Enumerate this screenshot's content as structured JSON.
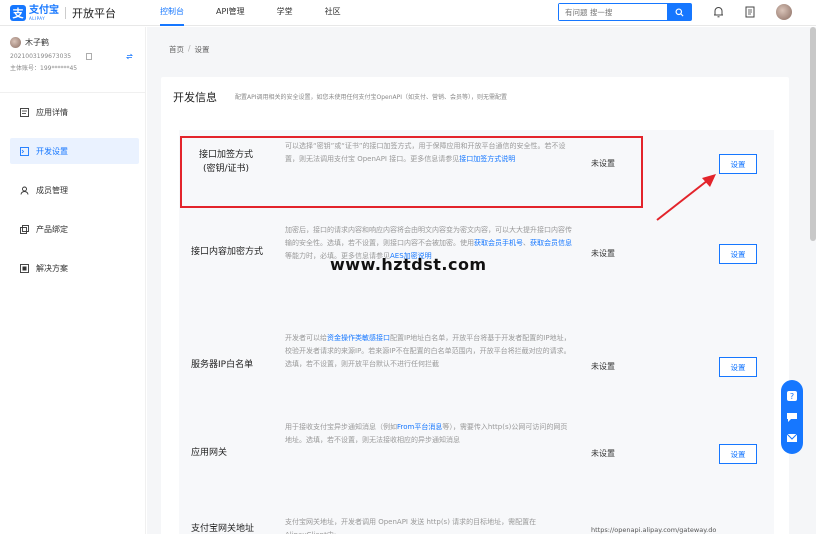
{
  "logo": {
    "mark": "支",
    "name_cn": "支付宝",
    "name_en": "ALIPAY",
    "product": "开放平台"
  },
  "nav": {
    "items": [
      {
        "label": "控制台",
        "active": true
      },
      {
        "label": "API管理",
        "active": false
      },
      {
        "label": "学堂",
        "active": false
      },
      {
        "label": "社区",
        "active": false
      }
    ]
  },
  "search": {
    "placeholder": "有问题 搜一搜"
  },
  "user": {
    "name": "木子鹤",
    "account_id": "2021003199673035",
    "main_account": "主体账号：199******45"
  },
  "sidebar": {
    "items": [
      {
        "label": "应用详情",
        "active": false
      },
      {
        "label": "开发设置",
        "active": true
      },
      {
        "label": "成员管理",
        "active": false
      },
      {
        "label": "产品绑定",
        "active": false
      },
      {
        "label": "解决方案",
        "active": false
      }
    ]
  },
  "breadcrumb": {
    "home": "首页",
    "sep": "/",
    "current": "设置"
  },
  "panel": {
    "title": "开发信息",
    "desc": "配置API调用相关的安全设置，如您未使用任何支付宝OpenAPI（如支付、营销、会员等），则无需配置"
  },
  "rows": [
    {
      "label_line1": "接口加签方式",
      "label_line2": "(密钥/证书)",
      "desc_text": "可以选择“密钥”或“证书”的接口加签方式，用于保障应用和开放平台通信的安全性。若不设置，则无法调用支付宝 OpenAPI 接口。更多信息请参见",
      "desc_link": "接口加签方式说明",
      "status": "未设置",
      "button": "设置"
    },
    {
      "label_line1": "接口内容加密方式",
      "desc_text": "加密后，接口的请求内容和响应内容将会由明文内容变为密文内容，可以大大提升接口内容传输的安全性。选填，若不设置，则接口内容不会被加密。使用",
      "desc_link1": "获取会员手机号",
      "desc_mid": "、",
      "desc_link2": "获取会员信息",
      "desc_text2": "等能力时，必填。更多信息请参见",
      "desc_link3": "AES加密说明",
      "status": "未设置",
      "button": "设置"
    },
    {
      "label_line1": "服务器IP白名单",
      "desc_text": "开发者可以给",
      "desc_link": "资金操作类敏感接口",
      "desc_text2": "配置IP地址白名单，开放平台将基于开发者配置的IP地址，校验开发者请求的来源IP。若来源IP不在配置的白名单范围内，开放平台将拦截对应的请求。选填，若不设置，则开放平台默认不进行任何拦截",
      "status": "未设置",
      "button": "设置"
    },
    {
      "label_line1": "应用网关",
      "desc_text": "用于接收支付宝异步通知消息（例如",
      "desc_link": "From平台消息",
      "desc_text2": "等），需要传入http(s)公网可访问的网页地址。选填，若不设置，则无法接收相应的异步通知消息",
      "status": "未设置",
      "button": "设置"
    },
    {
      "label_line1": "支付宝网关地址",
      "desc_text": "支付宝网关地址，开发者调用 OpenAPI 发送 http(s) 请求的目标地址，需配置在AlipayClient中;",
      "status": "https://openapi.alipay.com/gateway.do"
    }
  ],
  "watermark": "www.hztdst.com",
  "colors": {
    "primary": "#1677ff",
    "highlight": "#e3242b"
  }
}
